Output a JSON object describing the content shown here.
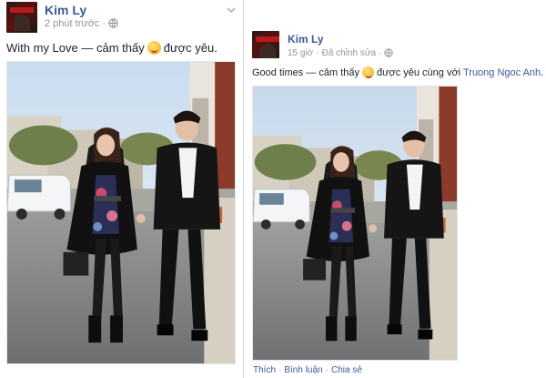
{
  "left_post": {
    "author": "Kim Ly",
    "time": "2 phút trước",
    "separator": "·",
    "status_prefix": "With my Love — cảm thấy",
    "status_feeling": "được yêu."
  },
  "right_post": {
    "author": "Kim Ly",
    "time": "15 giờ",
    "separator": "·",
    "edited": "Đã chỉnh sửa",
    "status_prefix": "Good times — cảm thấy",
    "status_feeling": "được yêu cùng với",
    "tagged_person": "Truong Ngoc Anh",
    "status_suffix": ".",
    "actions": {
      "like": "Thích",
      "comment": "Bình luận",
      "share": "Chia sẻ",
      "separator": "·"
    }
  },
  "icons": {
    "privacy": "globe-icon",
    "feeling": "smiley-emoji-icon",
    "menu": "chevron-down-icon"
  },
  "colors": {
    "link": "#3b5998",
    "meta": "#90949c",
    "text": "#1d2129"
  }
}
